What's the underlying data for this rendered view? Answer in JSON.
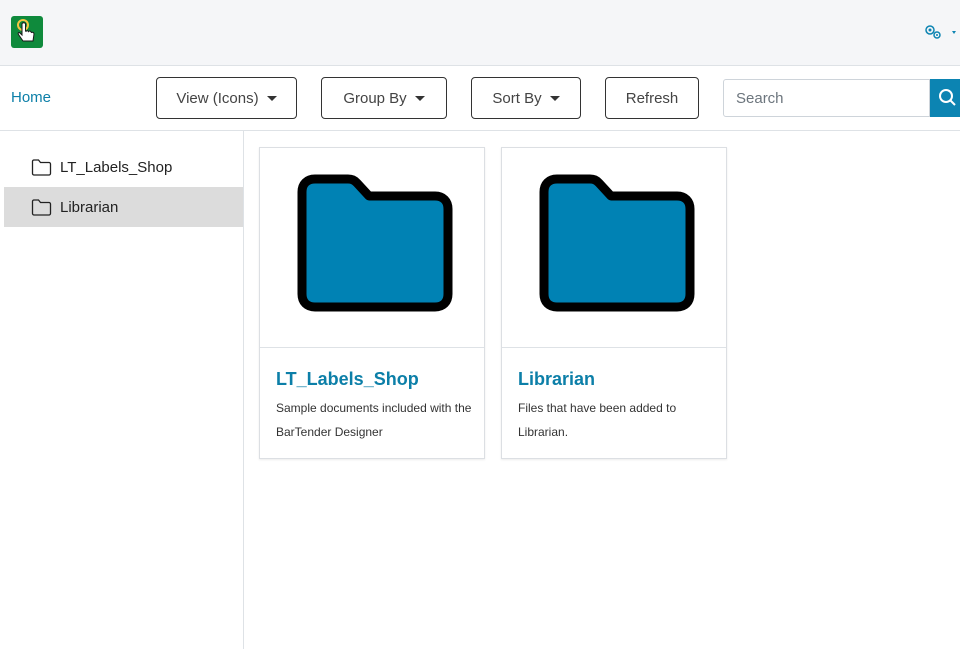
{
  "header": {
    "logo_icon": "hand-pointer-app-icon",
    "settings_icon": "gears-icon",
    "accent_color": "#0c84b2",
    "logo_color": "#0f8a3c"
  },
  "toolbar": {
    "home_label": "Home",
    "view_label": "View (Icons)",
    "group_label": "Group By",
    "sort_label": "Sort By",
    "refresh_label": "Refresh",
    "search_placeholder": "Search",
    "search_icon": "search-icon"
  },
  "sidebar": {
    "items": [
      {
        "label": "LT_Labels_Shop",
        "icon": "folder-outline-icon",
        "selected": false
      },
      {
        "label": "Librarian",
        "icon": "folder-outline-icon",
        "selected": true
      }
    ]
  },
  "main": {
    "cards": [
      {
        "title": "LT_Labels_Shop",
        "description": "Sample documents included with the BarTender Designer",
        "icon": "folder-icon",
        "folder_color": "#0082b4"
      },
      {
        "title": "Librarian",
        "description": "Files that have been added to Librarian.",
        "icon": "folder-icon",
        "folder_color": "#0082b4"
      }
    ]
  }
}
